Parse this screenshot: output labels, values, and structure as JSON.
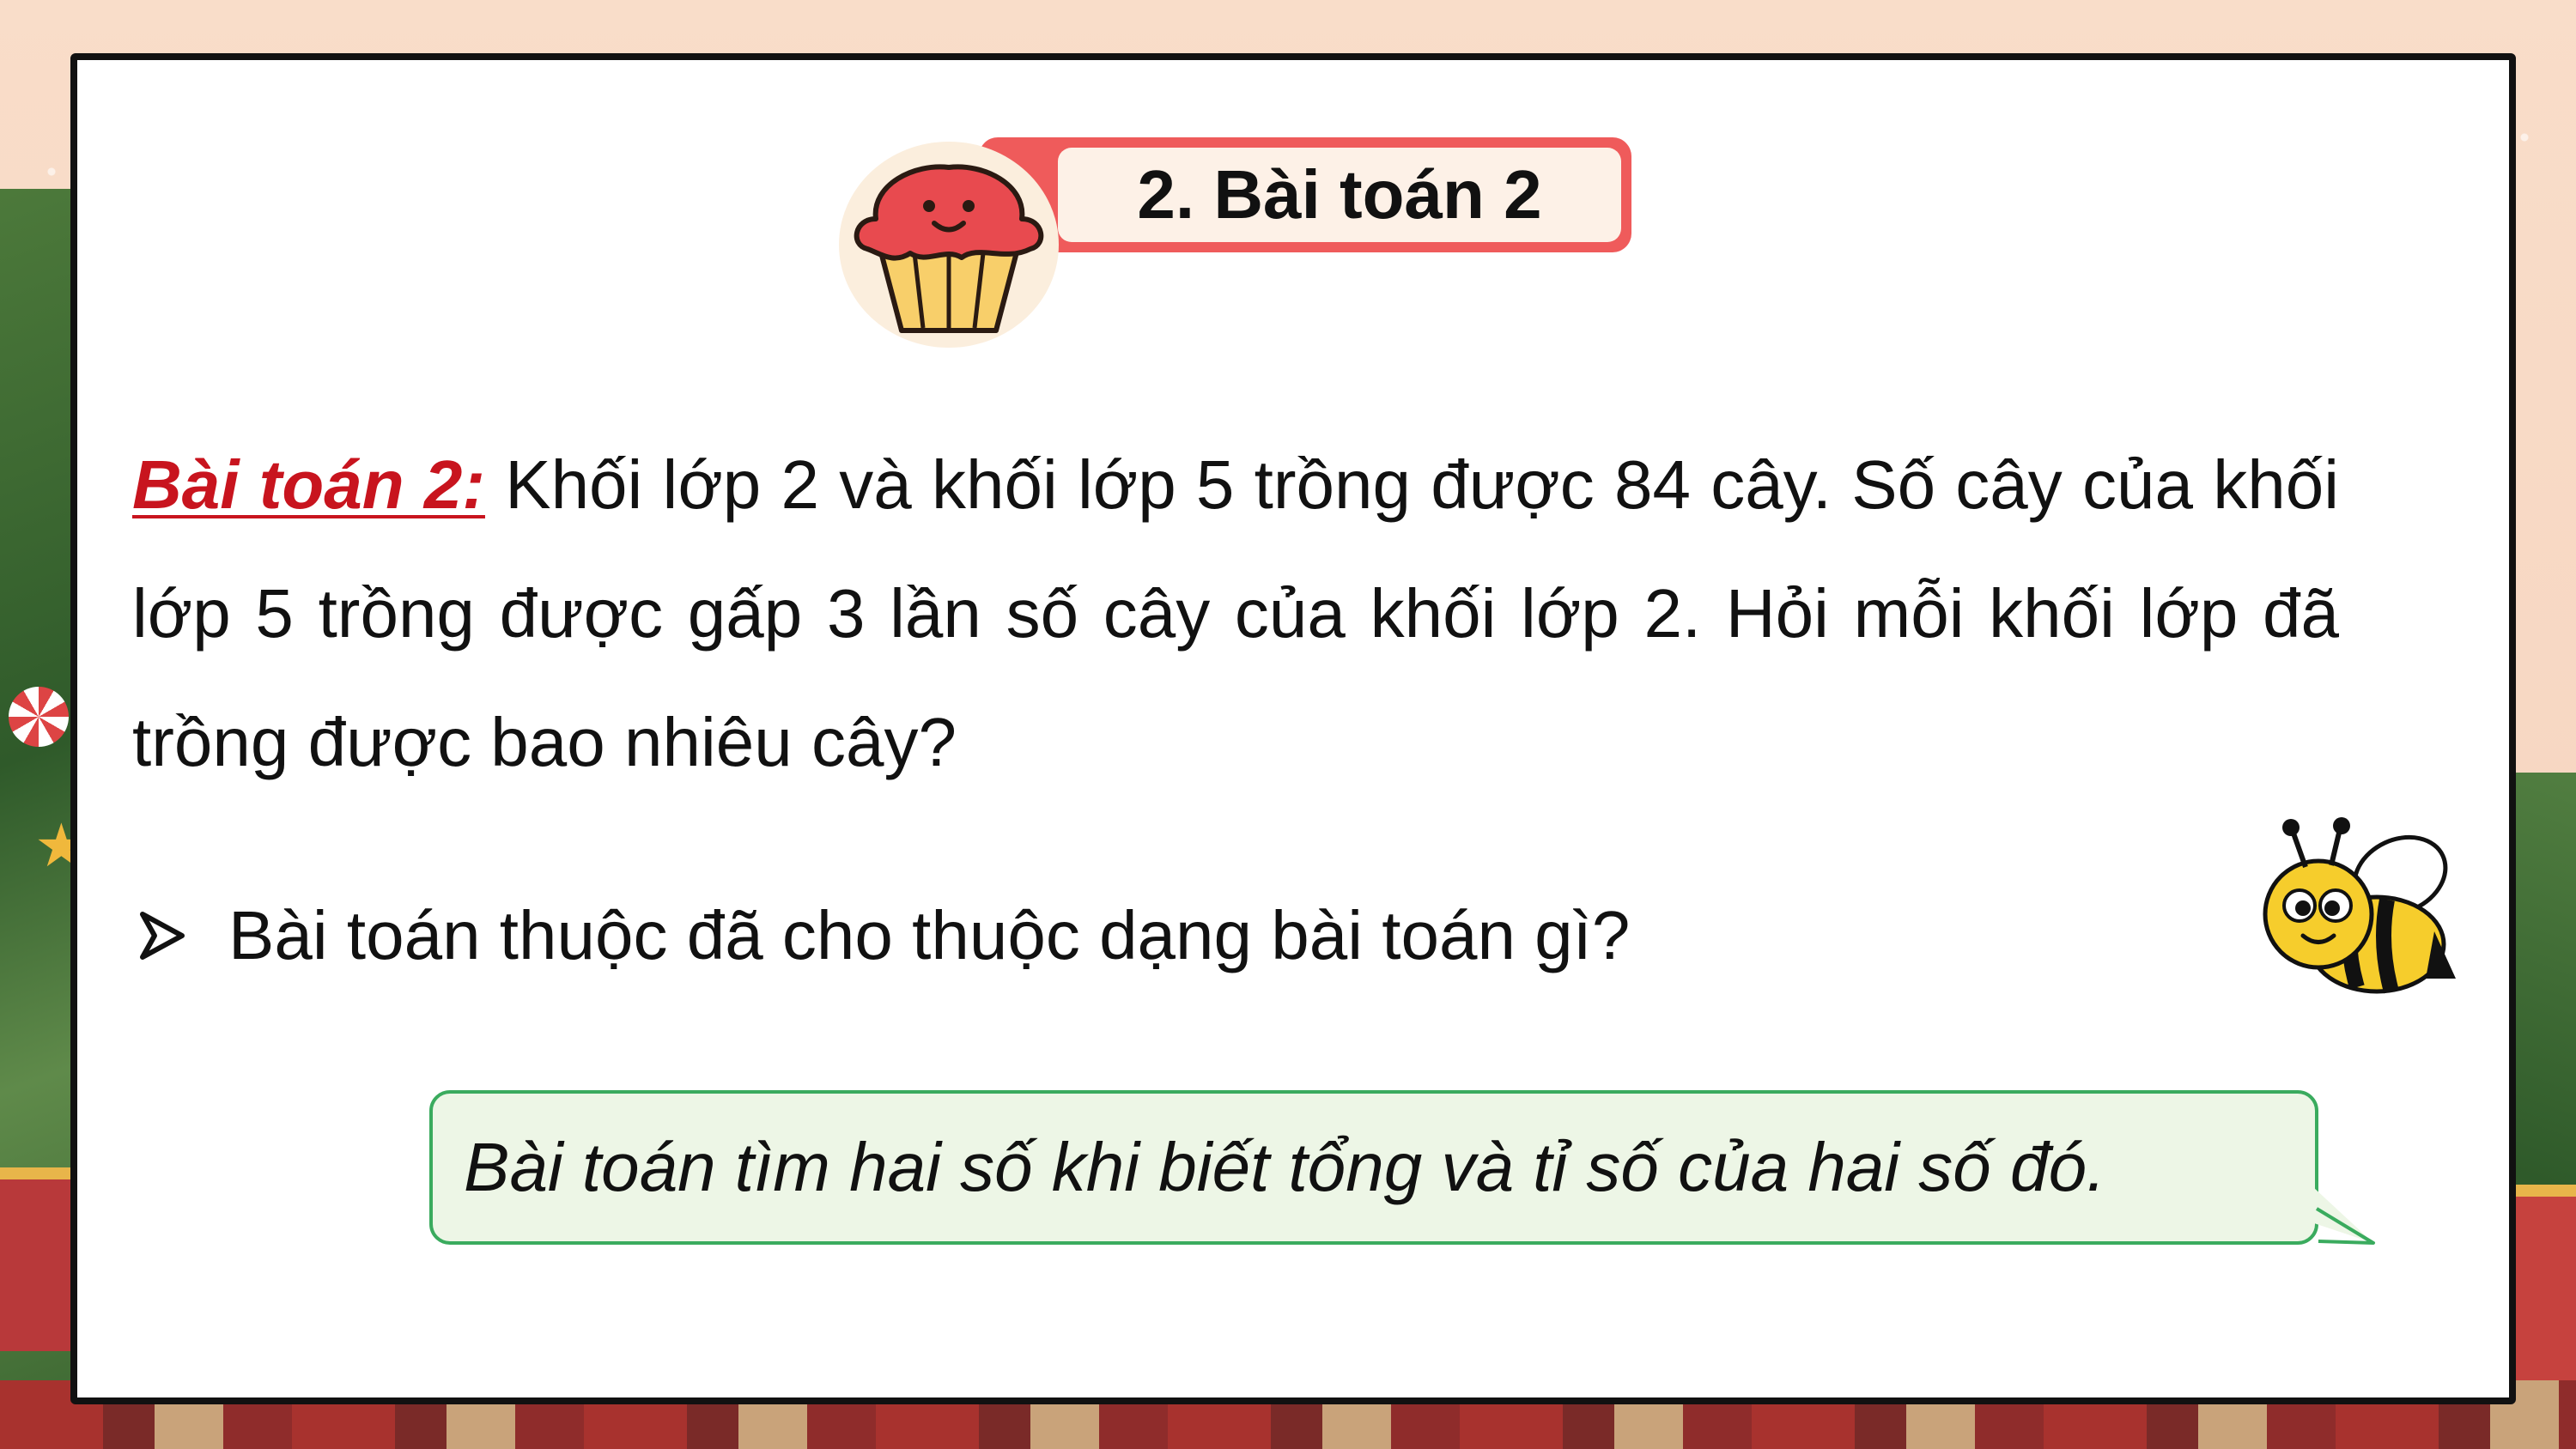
{
  "slide": {
    "title": "2. Bài toán 2",
    "problem": {
      "label": "Bài toán 2:",
      "text": " Khối lớp 2 và khối lớp 5 trồng được 84 cây. Số cây của khối lớp 5 trồng được gấp 3 lần số cây của khối lớp 2. Hỏi mỗi khối lớp đã trồng được bao nhiêu cây?"
    },
    "question": "Bài toán thuộc đã cho thuộc dạng bài toán gì?",
    "answer": "Bài toán tìm hai số khi biết tổng và tỉ số của hai số đó."
  },
  "colors": {
    "label_red": "#c8141e",
    "pill_red": "#ef5b5b",
    "pill_cream": "#fdf1e7",
    "bubble_fill": "#edf6e6",
    "bubble_border": "#3aab5e"
  },
  "icons": {
    "title_decoration": "cupcake-icon",
    "bullet": "arrow-bullet-icon",
    "mascot": "bee-icon"
  }
}
